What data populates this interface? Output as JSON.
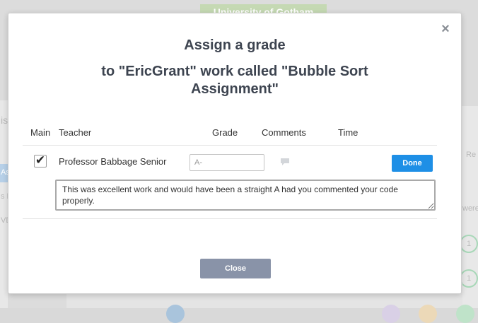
{
  "background": {
    "banner": "University of Gotham",
    "fragments": [
      "is",
      "Re",
      "As",
      "s E",
      "VD",
      "were",
      "1",
      "1"
    ]
  },
  "modal": {
    "title": "Assign a grade",
    "subtitle": "to \"EricGrant\" work called \"Bubble Sort Assignment\"",
    "close_icon": "close-icon",
    "columns": {
      "main": "Main",
      "teacher": "Teacher",
      "grade": "Grade",
      "comments": "Comments",
      "time": "Time"
    },
    "row": {
      "main_checked": true,
      "check_glyph": "✔",
      "teacher": "Professor Babbage Senior",
      "grade_value": "A-",
      "comment_icon": "speech-bubble-icon",
      "time": "",
      "done_label": "Done",
      "comment_text": "This was excellent work and would have been a straight A had you commented your code properly."
    },
    "close_label": "Close"
  },
  "colors": {
    "done_button": "#1e8fe6",
    "close_button": "#8993a8",
    "title_text": "#3d4450",
    "banner": "#c5d9b3"
  }
}
